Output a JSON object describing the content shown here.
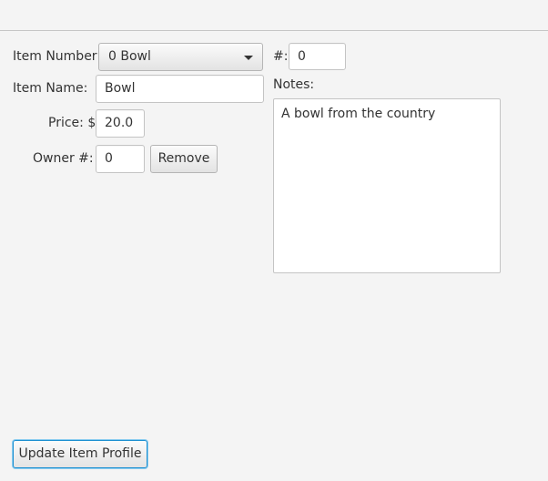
{
  "form": {
    "item_number_label": "Item Number:",
    "item_number_selected": "0 Bowl",
    "hash_label": "#:",
    "hash_value": "0",
    "item_name_label": "Item Name:",
    "item_name_value": "Bowl",
    "notes_label": "Notes:",
    "notes_value": "A bowl from the country",
    "price_label": "Price: $",
    "price_value": "20.0",
    "owner_label": "Owner #:",
    "owner_value": "0",
    "remove_label": "Remove",
    "update_label": "Update Item Profile"
  }
}
